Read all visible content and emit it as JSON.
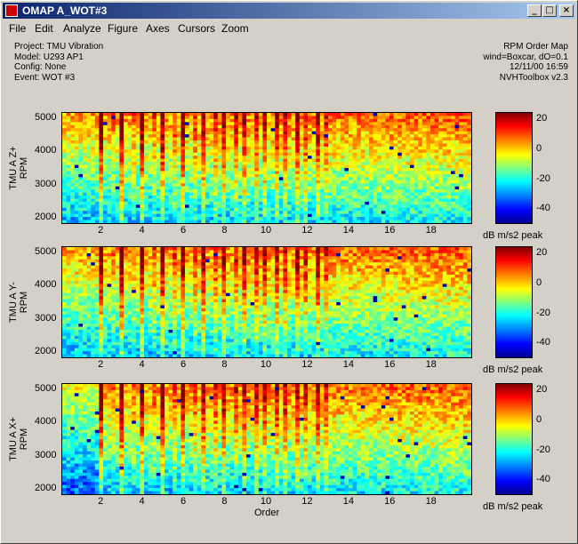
{
  "window": {
    "title": "OMAP A_WOT#3",
    "buttons": {
      "minimize": "_",
      "maximize": "□",
      "close": "×"
    }
  },
  "menu": [
    "File",
    "Edit",
    "Analyze",
    "Figure",
    "Axes",
    "Cursors",
    "Zoom"
  ],
  "info_left": [
    "Project:  TMU Vibration",
    "Model:    U293 AP1",
    "Config:   None",
    "Event:    WOT #3"
  ],
  "info_right": [
    "RPM Order Map",
    "wind=Boxcar, dO=0.1",
    "12/11/00  16:59",
    "NVHToolbox v2.3"
  ],
  "chart_data": [
    {
      "type": "heatmap",
      "ylabel": "TMU A Z+\nRPM",
      "xlabel": "",
      "xticks": [
        2,
        4,
        6,
        8,
        10,
        12,
        14,
        16,
        18
      ],
      "yticks": [
        2000,
        3000,
        4000,
        5000
      ],
      "xlim": [
        0.1,
        20
      ],
      "ylim": [
        1800,
        5200
      ],
      "colorbar": {
        "ticks": [
          20,
          0,
          -20,
          -40
        ],
        "clim": [
          -50,
          25
        ],
        "label": "dB m/s2 peak"
      }
    },
    {
      "type": "heatmap",
      "ylabel": "TMU A Y-\nRPM",
      "xlabel": "",
      "xticks": [
        2,
        4,
        6,
        8,
        10,
        12,
        14,
        16,
        18
      ],
      "yticks": [
        2000,
        3000,
        4000,
        5000
      ],
      "xlim": [
        0.1,
        20
      ],
      "ylim": [
        1800,
        5200
      ],
      "colorbar": {
        "ticks": [
          20,
          0,
          -20,
          -40
        ],
        "clim": [
          -50,
          25
        ],
        "label": "dB m/s2 peak"
      }
    },
    {
      "type": "heatmap",
      "ylabel": "TMU A X+\nRPM",
      "xlabel": "Order",
      "xticks": [
        2,
        4,
        6,
        8,
        10,
        12,
        14,
        16,
        18
      ],
      "yticks": [
        2000,
        3000,
        4000,
        5000
      ],
      "xlim": [
        0.1,
        20
      ],
      "ylim": [
        1800,
        5200
      ],
      "colorbar": {
        "ticks": [
          20,
          0,
          -20,
          -40
        ],
        "clim": [
          -50,
          25
        ],
        "label": "dB m/s2 peak"
      }
    }
  ]
}
